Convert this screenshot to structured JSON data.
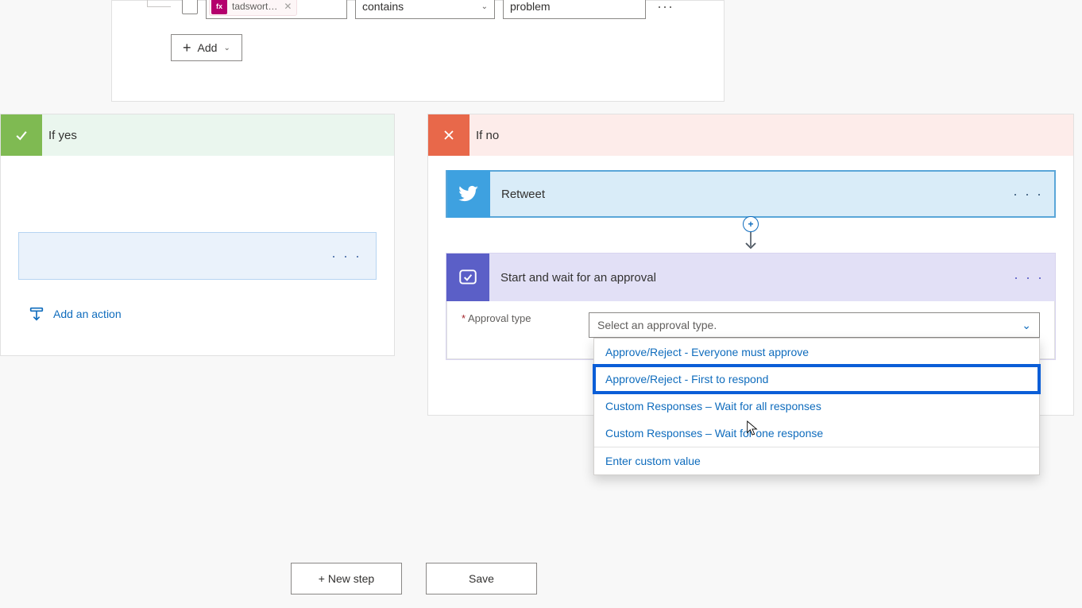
{
  "condition": {
    "pill_text": "tadswort…",
    "operator": "contains",
    "value": "problem",
    "add_label": "Add"
  },
  "yes": {
    "title": "If yes",
    "add_action": "Add an action"
  },
  "no": {
    "title": "If no",
    "retweet": "Retweet",
    "approval": {
      "title": "Start and wait for an approval",
      "label": "Approval type",
      "placeholder": "Select an approval type.",
      "options": [
        "Approve/Reject - Everyone must approve",
        "Approve/Reject - First to respond",
        "Custom Responses – Wait for all responses",
        "Custom Responses – Wait for one response"
      ],
      "enter_custom": "Enter custom value"
    }
  },
  "footer": {
    "new_step": "+ New step",
    "save": "Save"
  }
}
